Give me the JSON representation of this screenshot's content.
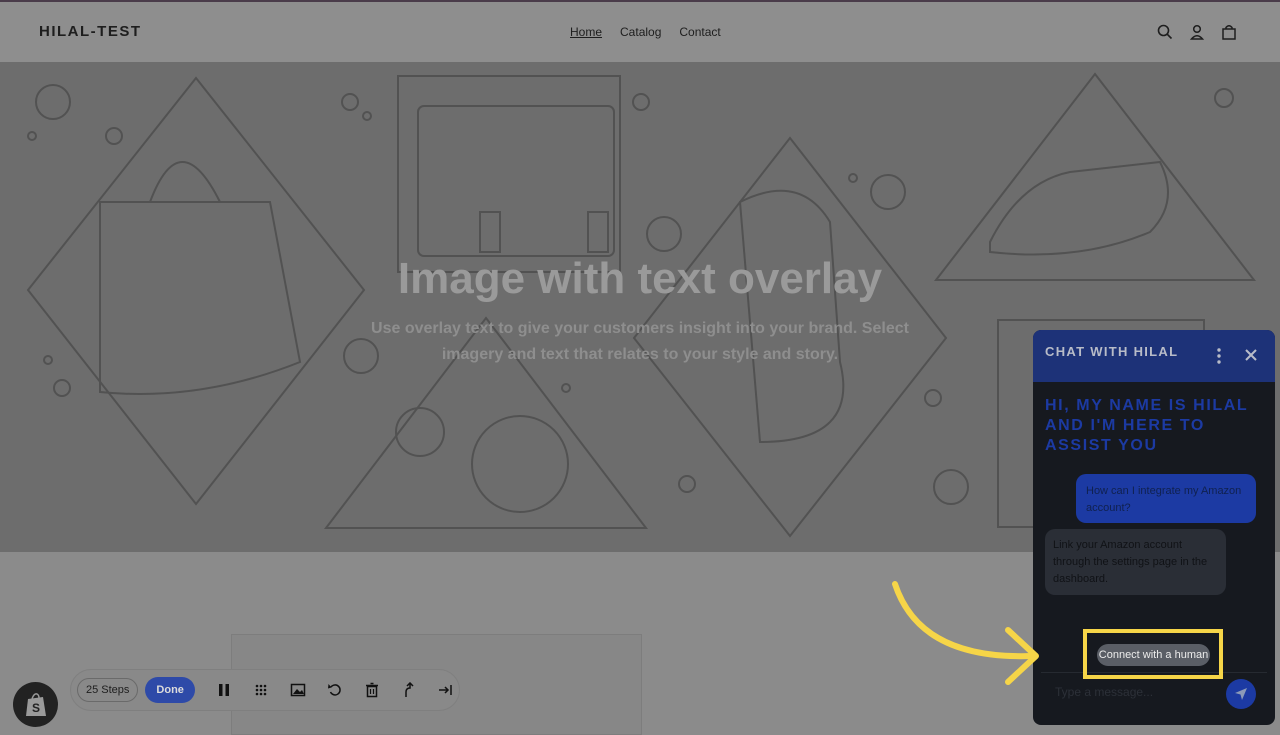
{
  "header": {
    "brand": "HILAL-TEST",
    "nav": [
      "Home",
      "Catalog",
      "Contact"
    ],
    "icons": [
      "search-icon",
      "account-icon",
      "cart-icon"
    ]
  },
  "hero": {
    "title": "Image with text overlay",
    "subtitle": "Use overlay text to give your customers insight into your brand. Select imagery and text that relates to your style and story."
  },
  "toolbar": {
    "steps_label": "25 Steps",
    "done_label": "Done",
    "icons": [
      "pause-icon",
      "blur-icon",
      "image-icon",
      "undo-icon",
      "trash-icon",
      "branch-arrow-icon",
      "skip-icon"
    ]
  },
  "chat": {
    "title": "CHAT WITH HILAL",
    "greeting": "HI, MY NAME IS HILAL AND I'M HERE TO ASSIST YOU",
    "user_message": "How can I integrate my Amazon account?",
    "bot_message": "Link your Amazon account through the settings page in the dashboard.",
    "connect_label": "Connect with a human",
    "input_placeholder": "Type a message..."
  },
  "colors": {
    "accent": "#1c3aa3",
    "highlight": "#f6d548",
    "chat_bg": "#16191f"
  }
}
